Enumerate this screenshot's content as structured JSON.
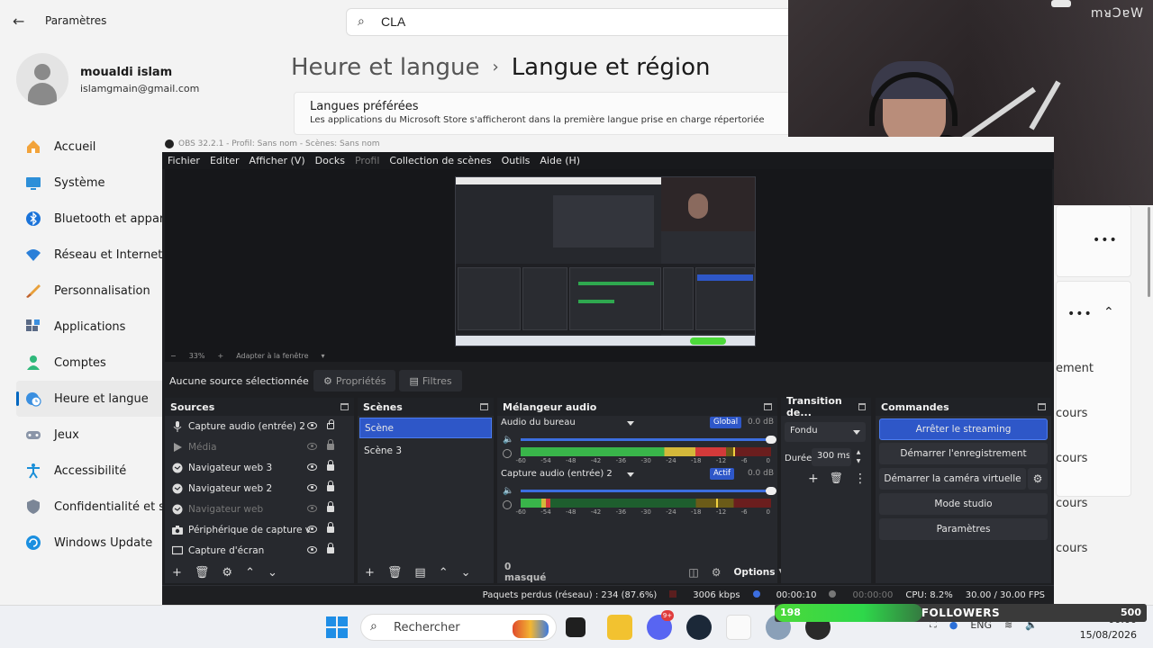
{
  "settings": {
    "app_title": "Paramètres",
    "search_value": "CLA",
    "user": {
      "name": "moualdi islam",
      "email": "islamgmain@gmail.com"
    },
    "nav": [
      {
        "label": "Accueil",
        "icon": "home-icon"
      },
      {
        "label": "Système",
        "icon": "monitor-icon"
      },
      {
        "label": "Bluetooth et appareils",
        "icon": "bluetooth-icon"
      },
      {
        "label": "Réseau et Internet",
        "icon": "wifi-icon"
      },
      {
        "label": "Personnalisation",
        "icon": "brush-icon"
      },
      {
        "label": "Applications",
        "icon": "apps-icon"
      },
      {
        "label": "Comptes",
        "icon": "account-icon"
      },
      {
        "label": "Heure et langue",
        "icon": "clock-globe-icon",
        "active": true
      },
      {
        "label": "Jeux",
        "icon": "gamepad-icon"
      },
      {
        "label": "Accessibilité",
        "icon": "accessibility-icon"
      },
      {
        "label": "Confidentialité et sécurité",
        "icon": "shield-icon"
      },
      {
        "label": "Windows Update",
        "icon": "update-icon"
      }
    ],
    "breadcrumb_parent": "Heure et langue",
    "breadcrumb_current": "Langue et région",
    "preferred_languages_title": "Langues préférées",
    "preferred_languages_desc": "Les applications du Microsoft Store s'afficheront dans la première langue prise en charge répertoriée",
    "right_panel_texts": [
      "ement",
      "cours",
      "cours",
      "cours",
      "cours"
    ]
  },
  "webcam": {
    "logo": "mᴚƆɐW"
  },
  "obs": {
    "title": "OBS 32.2.1 - Profil: Sans nom - Scènes: Sans nom",
    "menu": [
      "Fichier",
      "Editer",
      "Afficher (V)",
      "Docks",
      "Profil",
      "Collection de scènes",
      "Outils",
      "Aide (H)"
    ],
    "preview_toolbar": {
      "minus": "−",
      "zoom": "33%",
      "plus": "+",
      "fit": "Adapter à la fenêtre"
    },
    "no_source": "Aucune source sélectionnée",
    "properties_btn": "Propriétés",
    "filters_btn": "Filtres",
    "docks": {
      "sources": "Sources",
      "scenes": "Scènes",
      "mixer": "Mélangeur audio",
      "transitions": "Transition de...",
      "controls": "Commandes"
    },
    "sources": [
      {
        "name": "Capture audio (entrée) 2",
        "dim": false,
        "locked": false,
        "icon": "mic-icon"
      },
      {
        "name": "Média",
        "dim": true,
        "locked": false,
        "icon": "play-icon"
      },
      {
        "name": "Navigateur web 3",
        "dim": false,
        "locked": true,
        "icon": "globe-icon"
      },
      {
        "name": "Navigateur web 2",
        "dim": false,
        "locked": true,
        "icon": "globe-icon"
      },
      {
        "name": "Navigateur web",
        "dim": true,
        "locked": true,
        "icon": "globe-icon"
      },
      {
        "name": "Périphérique de capture vidéo",
        "dim": false,
        "locked": true,
        "icon": "camera-icon"
      },
      {
        "name": "Capture d'écran",
        "dim": false,
        "locked": true,
        "icon": "monitor-icon"
      }
    ],
    "scenes": [
      {
        "name": "Scène",
        "active": true
      },
      {
        "name": "Scène 3",
        "active": false
      }
    ],
    "mixer": [
      {
        "name": "Audio du bureau",
        "badge": "Global",
        "db": "0.0 dB",
        "level": 0.82,
        "peak": 0.85
      },
      {
        "name": "Capture audio (entrée) 2",
        "badge": "Actif",
        "db": "0.0 dB",
        "level": 0.12,
        "peak": 0.78
      }
    ],
    "mixer_scale": [
      "-60",
      "-54",
      "-48",
      "-42",
      "-36",
      "-30",
      "-24",
      "-18",
      "-12",
      "-6",
      "0"
    ],
    "mixer_footer": {
      "hidden": "0 masqué",
      "options": "Options"
    },
    "transition": {
      "type": "Fondu",
      "duration_label": "Durée",
      "duration_value": "300 ms"
    },
    "controls": {
      "stop_streaming": "Arrêter le streaming",
      "start_recording": "Démarrer l'enregistrement",
      "start_virtual_cam": "Démarrer la caméra virtuelle",
      "studio_mode": "Mode studio",
      "settings": "Paramètres"
    },
    "status": {
      "dropped": "Paquets perdus (réseau) : 234 (87.6%)",
      "kbps": "3006 kbps",
      "live_time": "00:00:10",
      "rec_time": "00:00:00",
      "cpu": "CPU: 8.2%",
      "fps": "30.00 / 30.00 FPS"
    }
  },
  "taskbar": {
    "search_placeholder": "Rechercher",
    "notification_badge": "9+",
    "lang": "ENG",
    "time": "00:00",
    "date": "15/08/2026"
  },
  "followers": {
    "current": "198",
    "label": "FOLLOWERS",
    "goal": "500",
    "progress": 0.396
  }
}
